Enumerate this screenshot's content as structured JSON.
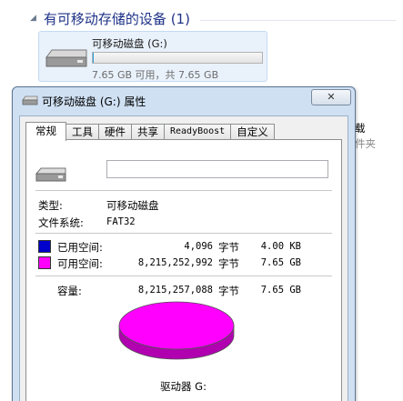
{
  "background": {
    "group_header": "有可移动存储的设备 (1)",
    "drive_tile": {
      "name": "可移动磁盘 (G:)",
      "usage_text": "7.65 GB 可用，共 7.65 GB",
      "used_fraction": 0.001
    },
    "side_text_1": "载",
    "side_text_2": "件夹"
  },
  "dialog": {
    "title": "可移动磁盘 (G:) 属性",
    "close_label": "✕",
    "tabs": [
      {
        "label": "常规",
        "active": true
      },
      {
        "label": "工具"
      },
      {
        "label": "硬件"
      },
      {
        "label": "共享"
      },
      {
        "label": "ReadyBoost"
      },
      {
        "label": "自定义"
      }
    ],
    "name_value": "",
    "type_label": "类型:",
    "type_value": "可移动磁盘",
    "fs_label": "文件系统:",
    "fs_value": "FAT32",
    "used": {
      "label": "已用空间:",
      "bytes": "4,096",
      "unit": "字节",
      "size": "4.00 KB",
      "color": "#0000cc"
    },
    "free": {
      "label": "可用空间:",
      "bytes": "8,215,252,992",
      "unit": "字节",
      "size": "7.65 GB",
      "color": "#ff00ff"
    },
    "capacity": {
      "label": "容量:",
      "bytes": "8,215,257,088",
      "unit": "字节",
      "size": "7.65 GB"
    },
    "drive_label": "驱动器 G:"
  },
  "colors": {
    "dialog_frame": "#cfe0f3",
    "selection_blue": "#26a0da",
    "free_color": "#ff00ff",
    "free_side": "#b000b0",
    "used_color": "#0000cc"
  }
}
